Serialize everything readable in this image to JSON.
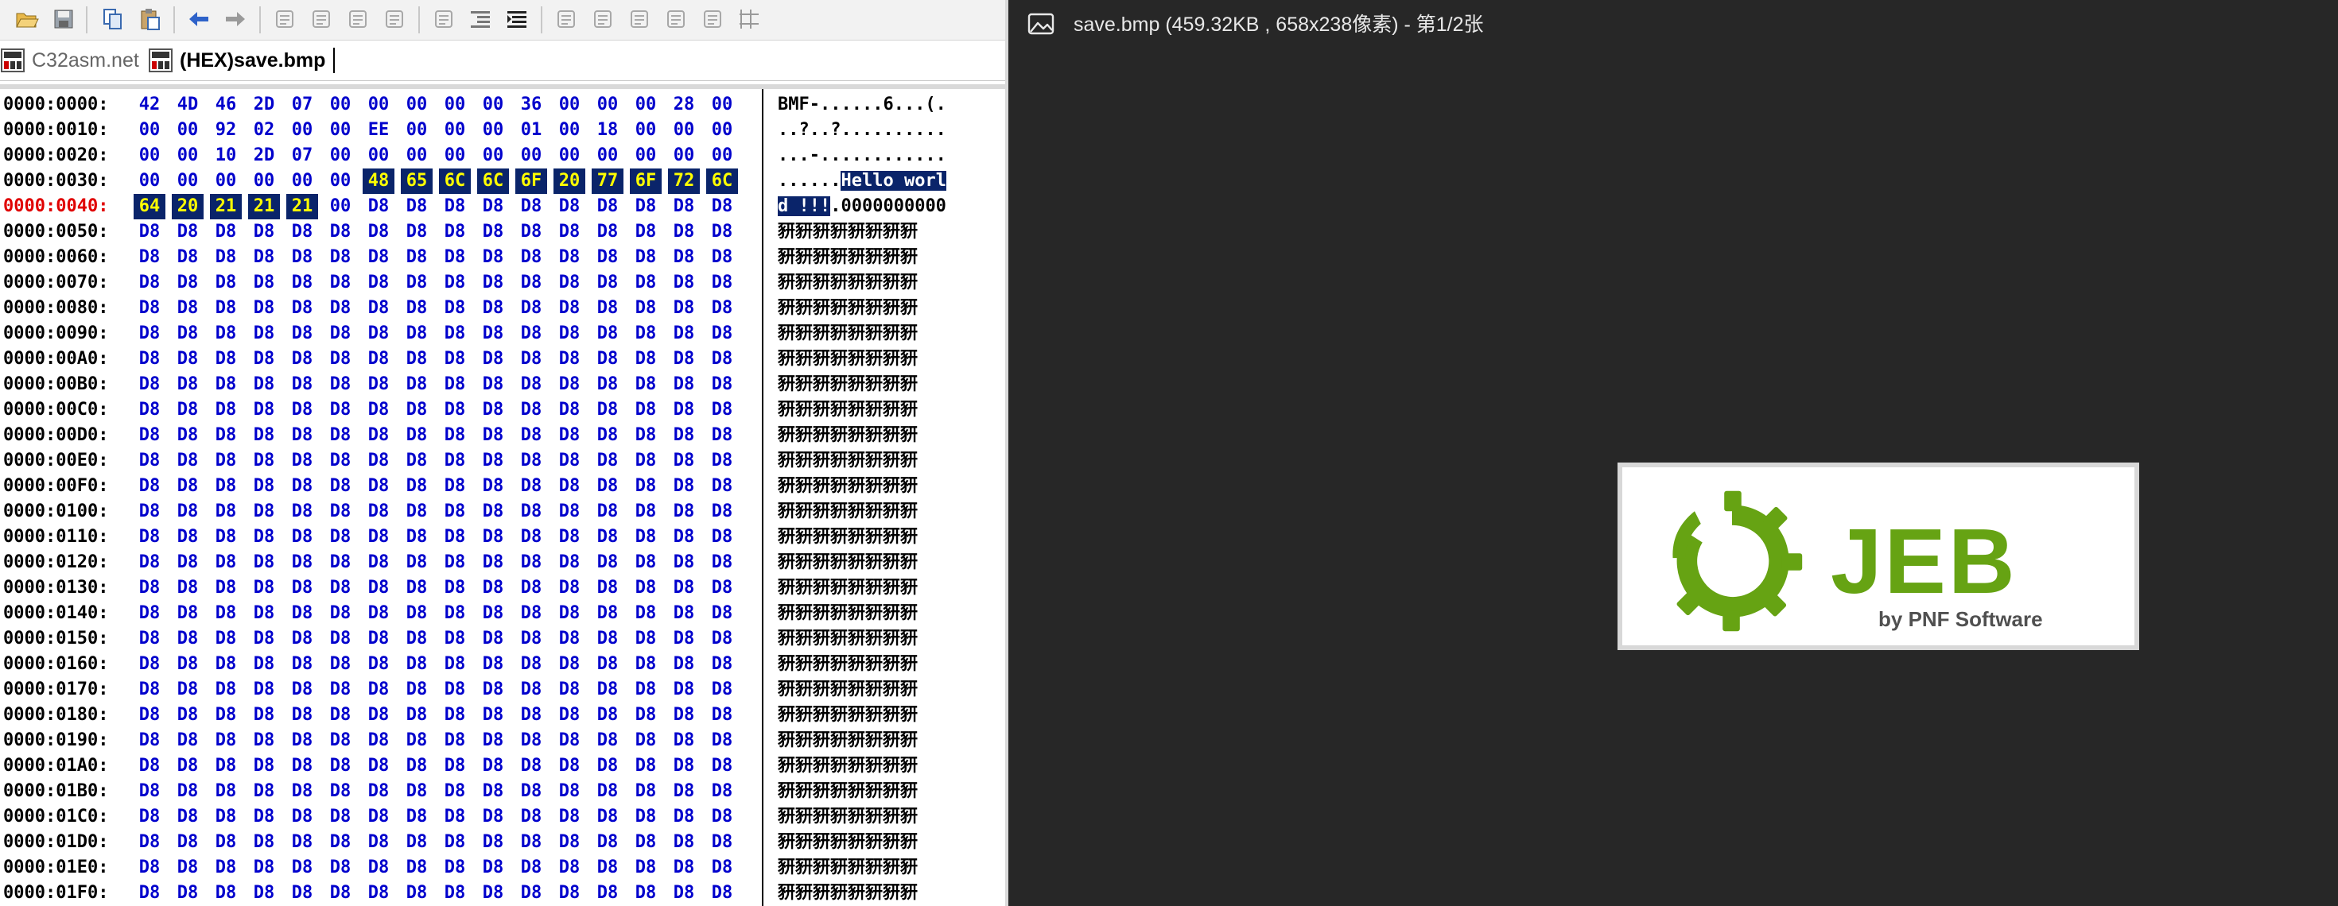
{
  "toolbar": {
    "icons": [
      "open-folder-icon",
      "save-icon",
      "copy-icon",
      "paste-icon",
      "back-arrow-icon",
      "forward-arrow-icon",
      "tool-1-icon",
      "tool-2-icon",
      "tool-3-icon",
      "tool-4-icon",
      "tool-5-icon",
      "indent-icon",
      "align-left-icon",
      "tool-6-icon",
      "tool-7-icon",
      "tool-8-icon",
      "tool-9-icon",
      "tool-10-icon",
      "grid-icon"
    ]
  },
  "tabs": [
    {
      "label": "C32asm.net",
      "active": false
    },
    {
      "label": "(HEX)save.bmp",
      "active": true
    }
  ],
  "hex": {
    "rows": [
      {
        "offset": "0000:0000:",
        "bytes": [
          "42",
          "4D",
          "46",
          "2D",
          "07",
          "00",
          "00",
          "00",
          "00",
          "00",
          "36",
          "00",
          "00",
          "00",
          "28",
          "00"
        ],
        "ascii": "BMF-......6...(."
      },
      {
        "offset": "0000:0010:",
        "bytes": [
          "00",
          "00",
          "92",
          "02",
          "00",
          "00",
          "EE",
          "00",
          "00",
          "00",
          "01",
          "00",
          "18",
          "00",
          "00",
          "00"
        ],
        "ascii": "..?..?.........."
      },
      {
        "offset": "0000:0020:",
        "bytes": [
          "00",
          "00",
          "10",
          "2D",
          "07",
          "00",
          "00",
          "00",
          "00",
          "00",
          "00",
          "00",
          "00",
          "00",
          "00",
          "00"
        ],
        "ascii": "...-............"
      },
      {
        "offset": "0000:0030:",
        "bytes": [
          "00",
          "00",
          "00",
          "00",
          "00",
          "00",
          "48",
          "65",
          "6C",
          "6C",
          "6F",
          "20",
          "77",
          "6F",
          "72",
          "6C"
        ],
        "ascii_plain": "......",
        "ascii_sel": "Hello worl"
      },
      {
        "offset": "0000:0040:",
        "bytes": [
          "64",
          "20",
          "21",
          "21",
          "21",
          "00",
          "D8",
          "D8",
          "D8",
          "D8",
          "D8",
          "D8",
          "D8",
          "D8",
          "D8",
          "D8"
        ],
        "ascii_sel": "d !!!",
        "ascii_plain": ".0000000000"
      },
      {
        "offset": "0000:0050:",
        "fill": "D8",
        "ascii": "豜豜豜豜豜豜豜豜"
      },
      {
        "offset": "0000:0060:",
        "fill": "D8",
        "ascii": "豜豜豜豜豜豜豜豜"
      },
      {
        "offset": "0000:0070:",
        "fill": "D8",
        "ascii": "豜豜豜豜豜豜豜豜"
      },
      {
        "offset": "0000:0080:",
        "fill": "D8",
        "ascii": "豜豜豜豜豜豜豜豜"
      },
      {
        "offset": "0000:0090:",
        "fill": "D8",
        "ascii": "豜豜豜豜豜豜豜豜"
      },
      {
        "offset": "0000:00A0:",
        "fill": "D8",
        "ascii": "豜豜豜豜豜豜豜豜"
      },
      {
        "offset": "0000:00B0:",
        "fill": "D8",
        "ascii": "豜豜豜豜豜豜豜豜"
      },
      {
        "offset": "0000:00C0:",
        "fill": "D8",
        "ascii": "豜豜豜豜豜豜豜豜"
      },
      {
        "offset": "0000:00D0:",
        "fill": "D8",
        "ascii": "豜豜豜豜豜豜豜豜"
      },
      {
        "offset": "0000:00E0:",
        "fill": "D8",
        "ascii": "豜豜豜豜豜豜豜豜"
      },
      {
        "offset": "0000:00F0:",
        "fill": "D8",
        "ascii": "豜豜豜豜豜豜豜豜"
      },
      {
        "offset": "0000:0100:",
        "fill": "D8",
        "ascii": "豜豜豜豜豜豜豜豜"
      },
      {
        "offset": "0000:0110:",
        "fill": "D8",
        "ascii": "豜豜豜豜豜豜豜豜"
      },
      {
        "offset": "0000:0120:",
        "fill": "D8",
        "ascii": "豜豜豜豜豜豜豜豜"
      },
      {
        "offset": "0000:0130:",
        "fill": "D8",
        "ascii": "豜豜豜豜豜豜豜豜"
      },
      {
        "offset": "0000:0140:",
        "fill": "D8",
        "ascii": "豜豜豜豜豜豜豜豜"
      },
      {
        "offset": "0000:0150:",
        "fill": "D8",
        "ascii": "豜豜豜豜豜豜豜豜"
      },
      {
        "offset": "0000:0160:",
        "fill": "D8",
        "ascii": "豜豜豜豜豜豜豜豜"
      },
      {
        "offset": "0000:0170:",
        "fill": "D8",
        "ascii": "豜豜豜豜豜豜豜豜"
      },
      {
        "offset": "0000:0180:",
        "fill": "D8",
        "ascii": "豜豜豜豜豜豜豜豜"
      },
      {
        "offset": "0000:0190:",
        "fill": "D8",
        "ascii": "豜豜豜豜豜豜豜豜"
      },
      {
        "offset": "0000:01A0:",
        "fill": "D8",
        "ascii": "豜豜豜豜豜豜豜豜"
      },
      {
        "offset": "0000:01B0:",
        "fill": "D8",
        "ascii": "豜豜豜豜豜豜豜豜"
      },
      {
        "offset": "0000:01C0:",
        "fill": "D8",
        "ascii": "豜豜豜豜豜豜豜豜"
      },
      {
        "offset": "0000:01D0:",
        "fill": "D8",
        "ascii": "豜豜豜豜豜豜豜豜"
      },
      {
        "offset": "0000:01E0:",
        "fill": "D8",
        "ascii": "豜豜豜豜豜豜豜豜"
      },
      {
        "offset": "0000:01F0:",
        "fill": "D8",
        "ascii": "豜豜豜豜豜豜豜豜"
      }
    ],
    "current_offset": "0000:0040:"
  },
  "viewer": {
    "title": "save.bmp (459.32KB , 658x238像素) - 第1/2张",
    "logo_text": "JEB",
    "logo_sub": "by PNF Software"
  },
  "colors": {
    "hex_byte": "#0000cc",
    "selection_bg": "#0a246a",
    "selection_hex_fg": "#ffff00",
    "current_offset": "#e00000",
    "viewer_bg": "#272727",
    "logo_green": "#66a313"
  }
}
